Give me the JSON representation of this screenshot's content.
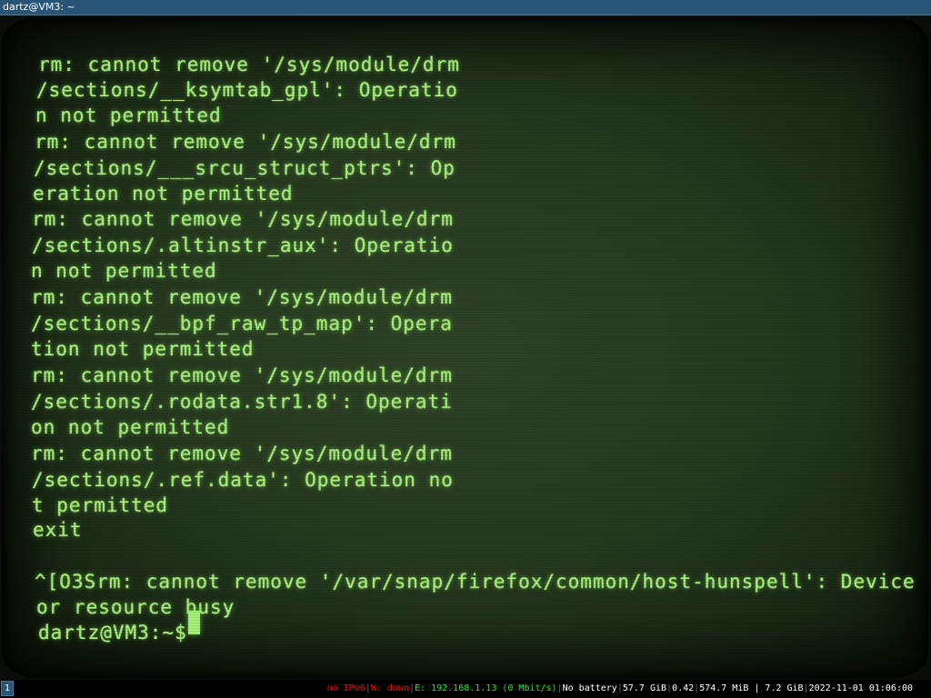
{
  "window": {
    "title": "dartz@VM3: ~"
  },
  "terminal": {
    "lines": [
      "rm: cannot remove '/sys/module/drm",
      "/sections/__ksymtab_gpl': Operatio",
      "n not permitted",
      "rm: cannot remove '/sys/module/drm",
      "/sections/___srcu_struct_ptrs': Op",
      "eration not permitted",
      "rm: cannot remove '/sys/module/drm",
      "/sections/.altinstr_aux': Operatio",
      "n not permitted",
      "rm: cannot remove '/sys/module/drm",
      "/sections/__bpf_raw_tp_map': Opera",
      "tion not permitted",
      "rm: cannot remove '/sys/module/drm",
      "/sections/.rodata.str1.8': Operati",
      "on not permitted",
      "rm: cannot remove '/sys/module/drm",
      "/sections/.ref.data': Operation no",
      "t permitted",
      "exit",
      "^[O3Srm: cannot remove '/var/snap/firefox/common/host-hunspell': Device",
      "or resource busy",
      "dartz@VM3:~$ "
    ]
  },
  "statusbar": {
    "workspace": "1",
    "ipv6": "no IPv6",
    "wireless": "W: down",
    "ethernet": "E: 192.168.1.13 (0 Mbit/s)",
    "battery": "No battery",
    "disk": "57.7 GiB",
    "load": "0.42",
    "memory": "574.7 MiB | 7.2 GiB",
    "datetime": "2022-11-01 01:06:00",
    "colors": {
      "bad": "#ff0000",
      "good": "#00ff00",
      "neutral": "#ffffff"
    }
  }
}
